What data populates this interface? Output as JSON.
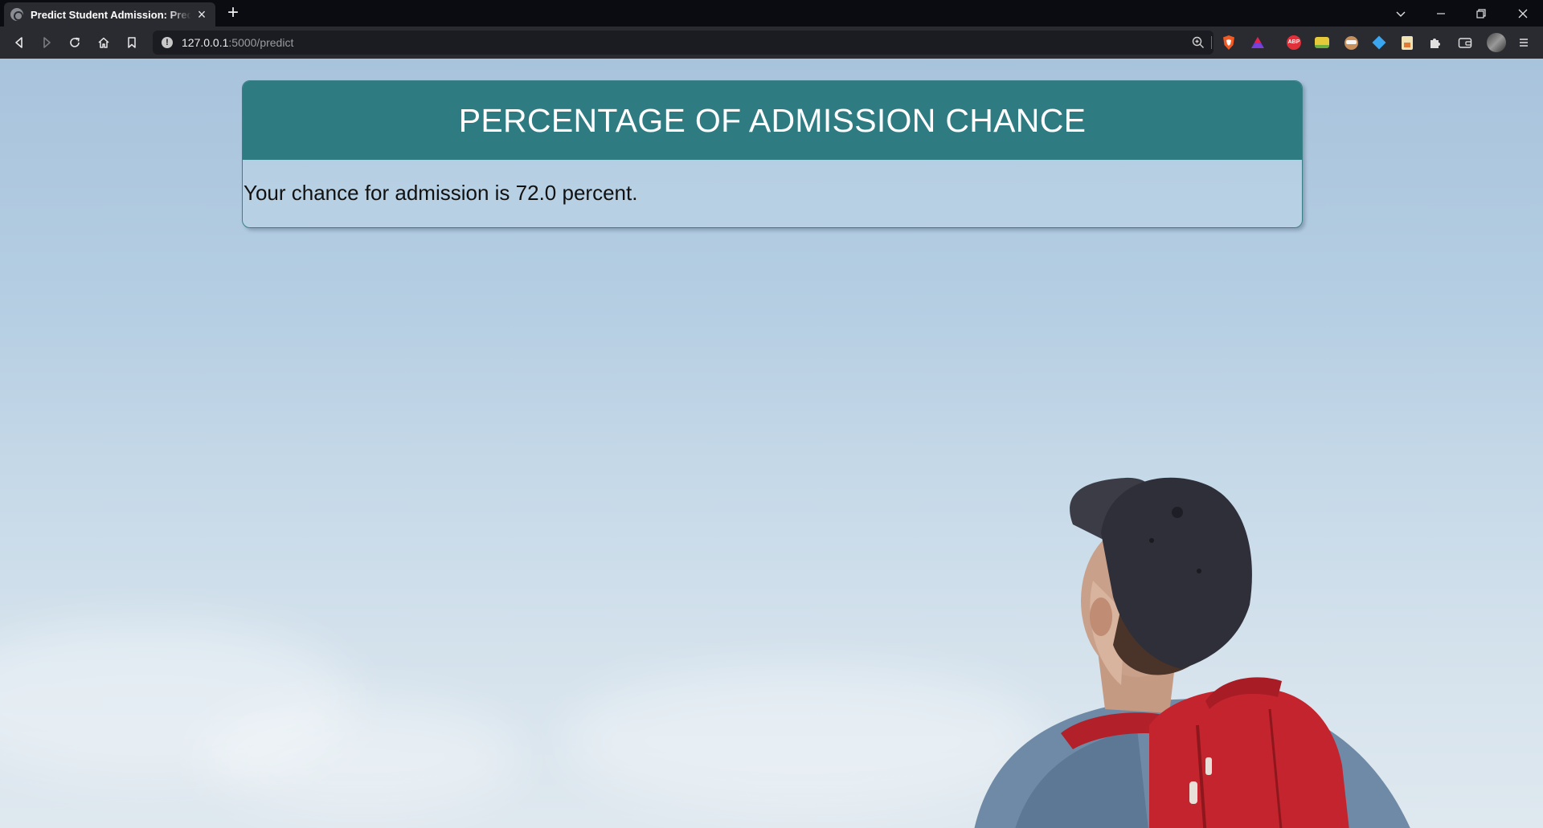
{
  "browser": {
    "tab": {
      "title": "Predict Student Admission: Predict",
      "close_glyph": "×"
    },
    "new_tab_glyph": "+",
    "address": {
      "host": "127.0.0.1",
      "path": ":5000/predict"
    },
    "extensions": [
      "brave-shields-icon",
      "brave-rewards-icon",
      "adblock-plus-icon",
      "extension-yellow-icon",
      "extension-face-icon",
      "extension-diamond-icon",
      "extension-doc-icon",
      "extensions-puzzle-icon",
      "wallet-icon",
      "profile-avatar",
      "menu-icon"
    ],
    "abp_label": "ABP"
  },
  "page": {
    "heading": "PERCENTAGE OF ADMISSION CHANCE",
    "result_text": "Your chance for admission is 72.0 percent.",
    "colors": {
      "header_bg": "#2f7b82",
      "sky_top": "#a8c3dc",
      "sky_bottom": "#dfe8ef",
      "backpack_red": "#c4242e",
      "cap_dark": "#2e2f38"
    }
  }
}
